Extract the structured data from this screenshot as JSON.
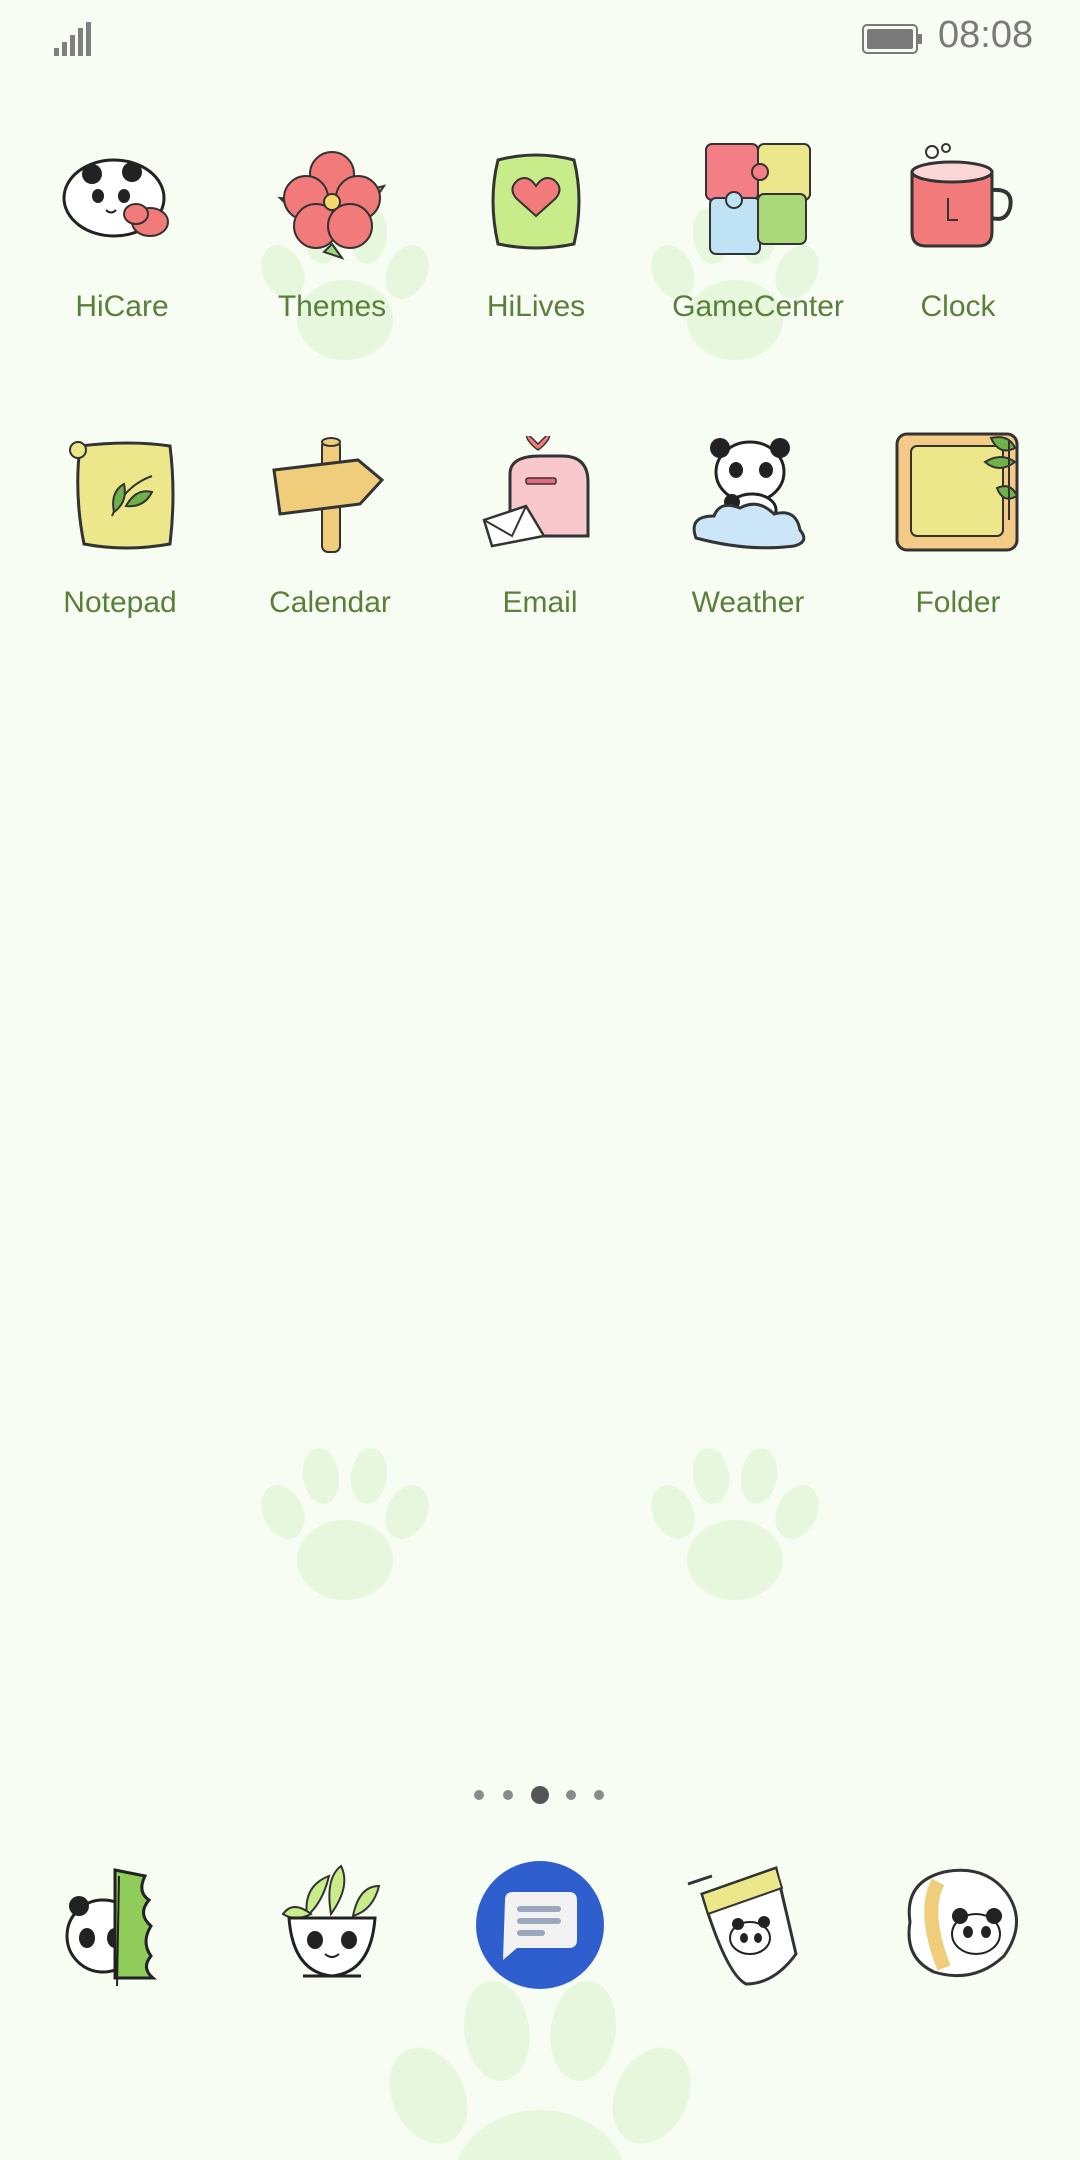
{
  "status_bar": {
    "time": "08:08",
    "signal_icon": "signal-bars-icon",
    "battery_icon": "battery-icon"
  },
  "apps_row1": [
    {
      "label": "HiCare",
      "icon": "panda-sleeping-icon"
    },
    {
      "label": "Themes",
      "icon": "flower-icon"
    },
    {
      "label": "HiLives",
      "icon": "heart-bag-icon"
    },
    {
      "label": "GameCenter",
      "icon": "puzzle-icon"
    },
    {
      "label": "Clock",
      "icon": "mug-icon"
    }
  ],
  "apps_row2": [
    {
      "label": "Notepad",
      "icon": "bamboo-paper-icon"
    },
    {
      "label": "Calendar",
      "icon": "signpost-icon"
    },
    {
      "label": "Email",
      "icon": "mailbox-icon"
    },
    {
      "label": "Weather",
      "icon": "panda-cloud-icon"
    },
    {
      "label": "Folder",
      "icon": "picture-frame-icon"
    }
  ],
  "page_indicator": {
    "count": 5,
    "active_index": 2
  },
  "dock": [
    {
      "icon": "panda-bamboo-icon"
    },
    {
      "icon": "panda-plant-pot-icon"
    },
    {
      "icon": "messages-icon"
    },
    {
      "icon": "panda-drink-cup-icon"
    },
    {
      "icon": "panda-bun-icon"
    }
  ],
  "colors": {
    "background": "#f7fdf3",
    "label": "#5b7f3a",
    "paw": "#dff5d4",
    "messages_blue": "#2f5fce"
  }
}
